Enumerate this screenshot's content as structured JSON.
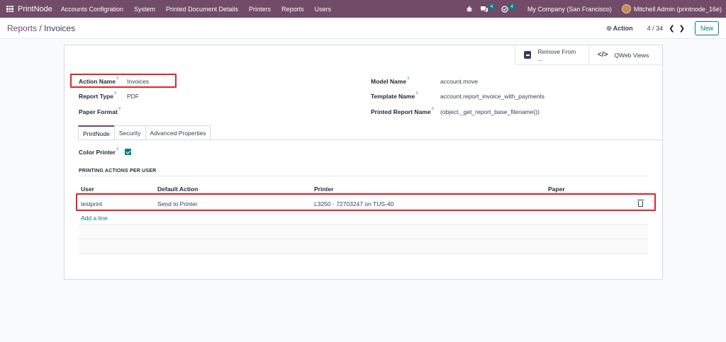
{
  "navbar": {
    "brand": "PrintNode",
    "menu": [
      "Accounts Configration",
      "System",
      "Printed Document Details",
      "Printers",
      "Reports",
      "Users"
    ],
    "messages_count": "4",
    "activities_count": "4",
    "company": "My Company (San Francisco)",
    "user": "Mitchell Admin (printnode_16e)"
  },
  "control": {
    "breadcrumb_parent": "Reports",
    "breadcrumb_sep": "/",
    "breadcrumb_current": "Invoices",
    "action_label": "Action",
    "pager": "4 / 34",
    "new_label": "New"
  },
  "button_box": {
    "remove_label": "Remove From ...",
    "qweb_label": "QWeb Views"
  },
  "form": {
    "action_name_label": "Action Name",
    "action_name_value": "Invoices",
    "report_type_label": "Report Type",
    "report_type_value": "PDF",
    "paper_format_label": "Paper Format",
    "model_name_label": "Model Name",
    "model_name_value": "account.move",
    "template_name_label": "Template Name",
    "template_name_value": "account.report_invoice_with_payments",
    "printed_report_name_label": "Printed Report Name",
    "printed_report_name_value": "(object._get_report_base_filename())",
    "help_mark": "?"
  },
  "tabs": [
    "PrintNode",
    "Security",
    "Advanced Properties"
  ],
  "printnode_tab": {
    "color_printer_label": "Color Printer",
    "color_printer_checked": true,
    "section_title": "PRINTING ACTIONS PER USER",
    "columns": [
      "User",
      "Default Action",
      "Printer",
      "Paper"
    ],
    "rows": [
      {
        "user": "testprint",
        "default_action": "Send to Printer",
        "printer": "L3250 - 72703247 on TUS-40",
        "paper": ""
      }
    ],
    "add_line": "Add a line"
  },
  "colors": {
    "brand": "#714b67",
    "accent": "#017e84",
    "highlight": "#e0242c"
  }
}
